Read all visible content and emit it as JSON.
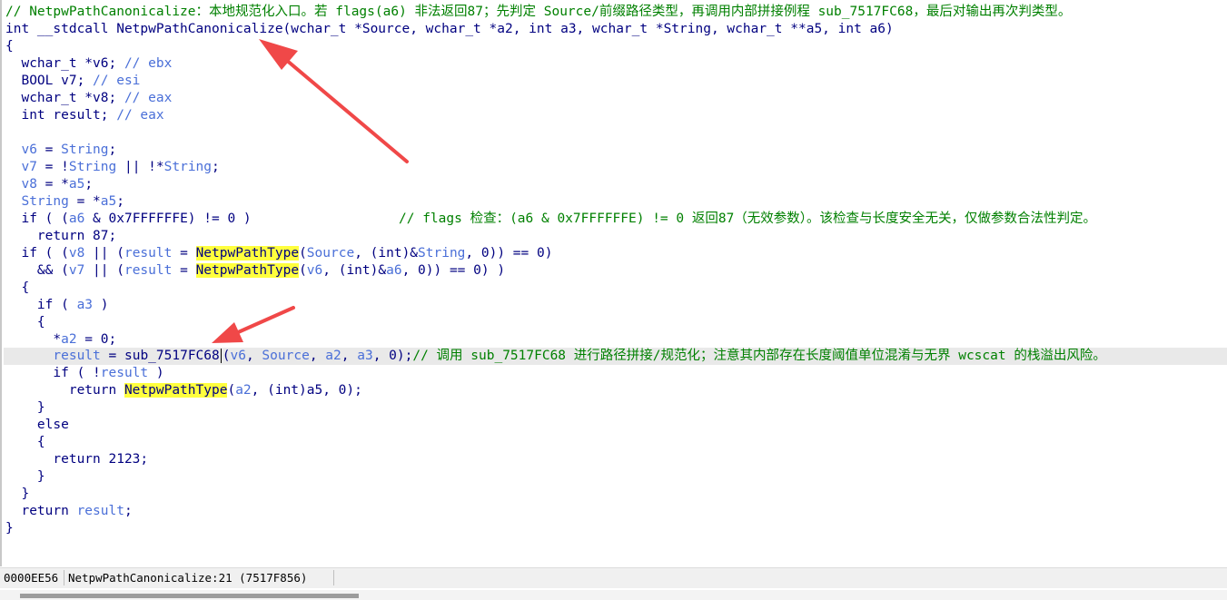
{
  "code": {
    "header_comment": "// NetpwPathCanonicalize：本地规范化入口。若 flags(a6) 非法返回87；先判定 Source/前缀路径类型，再调用内部拼接例程 sub_7517FC68，最后对输出再次判类型。",
    "sig_ret": "int __stdcall ",
    "sig_name": "NetpwPathCanonicalize",
    "sig_params": "(wchar_t *Source, wchar_t *a2, int a3, wchar_t *String, wchar_t **a5, int a6)",
    "open_brace": "{",
    "decl_v6_type": "  wchar_t *v6; ",
    "decl_v6_reg": "// ebx",
    "decl_v7_type": "  BOOL v7; ",
    "decl_v7_reg": "// esi",
    "decl_v8_type": "  wchar_t *v8; ",
    "decl_v8_reg": "// eax",
    "decl_res_type": "  int result; ",
    "decl_res_reg": "// eax",
    "l_v6_a": "  v6",
    "l_v6_b": " = ",
    "l_v6_c": "String",
    "l_v6_d": ";",
    "l_v7_a": "  v7",
    "l_v7_b": " = !",
    "l_v7_c": "String",
    "l_v7_d": " || !*",
    "l_v7_e": "String",
    "l_v7_f": ";",
    "l_v8_a": "  v8",
    "l_v8_b": " = *",
    "l_v8_c": "a5",
    "l_v8_d": ";",
    "l_str_a": "  String",
    "l_str_b": " = *",
    "l_str_c": "a5",
    "l_str_d": ";",
    "l_if1_a": "  if ( (",
    "l_if1_b": "a6",
    "l_if1_c": " & 0x7FFFFFFE) != 0 )",
    "l_if1_com": "// flags 检查：(a6 & 0x7FFFFFFE) != 0 返回87（无效参数）。该检查与长度安全无关，仅做参数合法性判定。",
    "l_ret87": "    return 87;",
    "l_if2_a": "  if ( (",
    "l_if2_b": "v8",
    "l_if2_c": " || (",
    "l_if2_d": "result",
    "l_if2_e": " = ",
    "l_if2_f": "NetpwPathType",
    "l_if2_g": "(",
    "l_if2_h": "Source",
    "l_if2_i": ", (int)&",
    "l_if2_j": "String",
    "l_if2_k": ", 0)) == 0)",
    "l_and_a": "    && (",
    "l_and_b": "v7",
    "l_and_c": " || (",
    "l_and_d": "result",
    "l_and_e": " = ",
    "l_and_f": "NetpwPathType",
    "l_and_g": "(",
    "l_and_h": "v6",
    "l_and_i": ", (int)&",
    "l_and_j": "a6",
    "l_and_k": ", 0)) == 0) )",
    "brace2": "  {",
    "l_ifa3_a": "    if ( ",
    "l_ifa3_b": "a3",
    "l_ifa3_c": " )",
    "brace3": "    {",
    "l_a2_a": "      *",
    "l_a2_b": "a2",
    "l_a2_c": " = 0;",
    "l_call_a": "      ",
    "l_call_b": "result",
    "l_call_c": " = ",
    "l_call_d": "sub_7517FC68",
    "l_call_e": "(",
    "l_call_f": "v6",
    "l_call_g": ", ",
    "l_call_h": "Source",
    "l_call_i": ", ",
    "l_call_j": "a2",
    "l_call_k": ", ",
    "l_call_l": "a3",
    "l_call_m": ", 0",
    "l_call_n": ");",
    "l_call_com": "// 调用 sub_7517FC68 进行路径拼接/规范化；注意其内部存在长度阈值单位混淆与无界 wcscat 的栈溢出风险。",
    "l_ifres_a": "      if ( !",
    "l_ifres_b": "result",
    "l_ifres_c": " )",
    "l_retpt_a": "        return ",
    "l_retpt_b": "NetpwPathType",
    "l_retpt_c": "(",
    "l_retpt_d": "a2",
    "l_retpt_e": ", (int)a5, 0);",
    "close3": "    }",
    "else": "    else",
    "brace4": "    {",
    "ret2123": "      return 2123;",
    "close4": "    }",
    "close2": "  }",
    "l_retres_a": "  return ",
    "l_retres_b": "result",
    "l_retres_c": ";",
    "close1": "}"
  },
  "status": {
    "address": "0000EE56",
    "location": "NetpwPathCanonicalize:21 (7517F856)"
  },
  "colors": {
    "comment": "#008000",
    "keyword": "#000080",
    "variable": "#4a6fd8",
    "highlight": "#ffff3d",
    "arrow": "#f04848"
  }
}
